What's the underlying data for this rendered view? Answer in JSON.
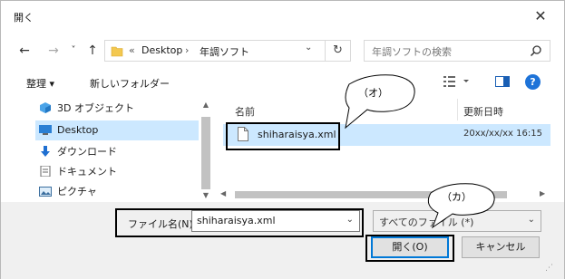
{
  "window": {
    "title": "開く",
    "close_glyph": "✕"
  },
  "nav": {
    "back": "←",
    "forward": "→",
    "recent": "˅",
    "up": "↑",
    "breadcrumb": [
      "«",
      "Desktop",
      "›",
      "年調ソフト"
    ],
    "refresh_glyph": "↻",
    "search_placeholder": "年調ソフトの検索"
  },
  "toolbar": {
    "organize": "整理 ▾",
    "new_folder": "新しいフォルダー"
  },
  "sidebar": {
    "items": [
      {
        "label": "3D オブジェクト",
        "icon": "3d-objects-icon"
      },
      {
        "label": "Desktop",
        "icon": "desktop-icon",
        "selected": true
      },
      {
        "label": "ダウンロード",
        "icon": "download-icon"
      },
      {
        "label": "ドキュメント",
        "icon": "document-icon"
      },
      {
        "label": "ピクチャ",
        "icon": "pictures-icon"
      }
    ]
  },
  "file_list": {
    "columns": [
      "名前",
      "更新日時"
    ],
    "rows": [
      {
        "name": "shiharaisya.xml",
        "date": "20xx/xx/xx 16:15",
        "icon": "xml-file-icon"
      }
    ]
  },
  "footer": {
    "filename_label": "ファイル名(N):",
    "filename_value": "shiharaisya.xml",
    "filter_value": "すべてのファイル (*)",
    "open_button": "開く(O)",
    "cancel_button": "キャンセル"
  },
  "annotations": {
    "callout_o": "（オ）",
    "callout_ka": "（カ）"
  },
  "colors": {
    "selection": "#cce8ff",
    "accent": "#0078d7",
    "help": "#1e73d8"
  }
}
